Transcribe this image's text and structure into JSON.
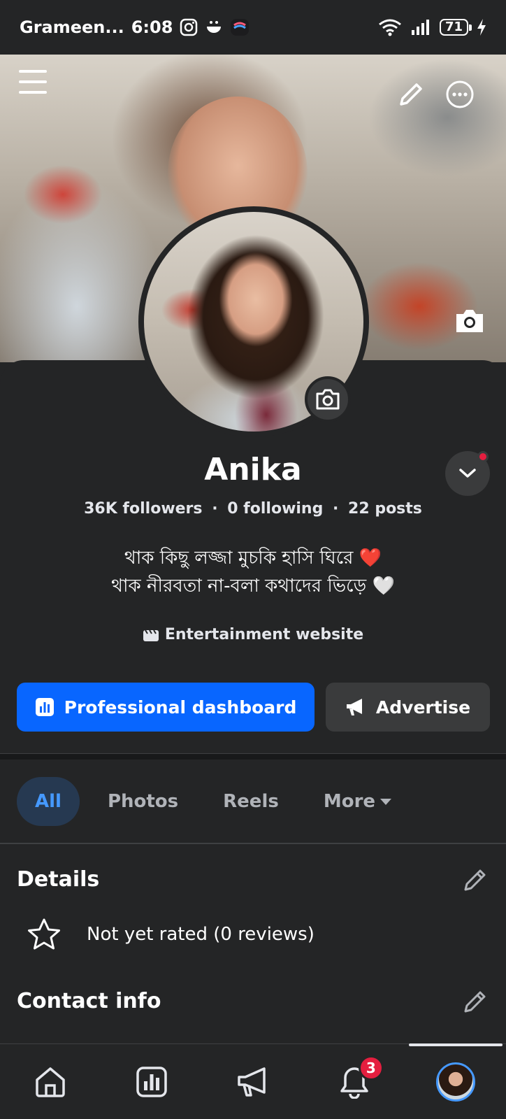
{
  "status_bar": {
    "carrier": "Grameen...",
    "time": "6:08",
    "battery": "71"
  },
  "profile": {
    "name": "Anika",
    "followers": "36K followers",
    "following": "0 following",
    "posts": "22 posts",
    "separator": "·",
    "bio_line1": "থাক কিছু লজ্জা মুচকি হাসি ঘিরে ❤️",
    "bio_line2": "থাক নীরবতা না-বলা কথাদের ভিড়ে 🤍",
    "category": "Entertainment website"
  },
  "actions": {
    "primary_label": "Professional dashboard",
    "secondary_label": "Advertise"
  },
  "tabs": [
    {
      "label": "All",
      "active": true
    },
    {
      "label": "Photos",
      "active": false
    },
    {
      "label": "Reels",
      "active": false
    },
    {
      "label": "More",
      "active": false
    }
  ],
  "details": {
    "title": "Details",
    "rating_text": "Not yet rated (0 reviews)"
  },
  "contact": {
    "title": "Contact info"
  },
  "bottom_nav": {
    "notification_count": "3"
  },
  "colors": {
    "accent": "#0866ff",
    "badge": "#e41e3f",
    "background": "#242526"
  }
}
